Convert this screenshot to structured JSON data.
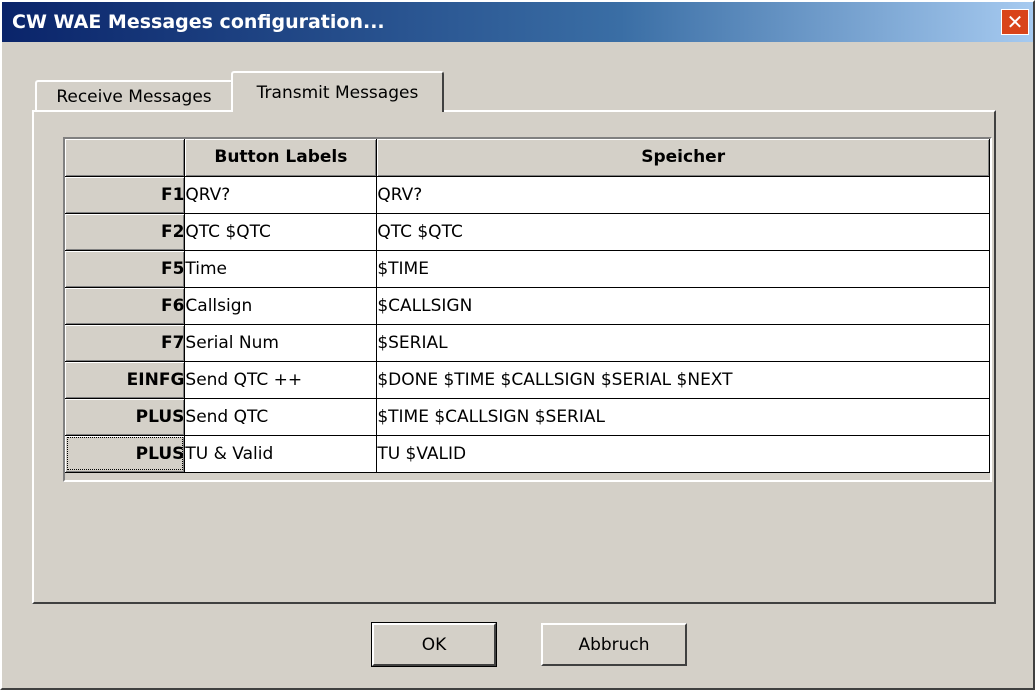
{
  "window": {
    "title": "CW WAE Messages configuration...",
    "close_label": "✕"
  },
  "tabs": [
    {
      "label": "Receive Messages",
      "active": false
    },
    {
      "label": "Transmit Messages",
      "active": true
    }
  ],
  "grid": {
    "headers": [
      "",
      "Button Labels",
      "Speicher"
    ],
    "rows": [
      {
        "key": "F1",
        "label": "QRV?",
        "memory": "QRV?"
      },
      {
        "key": "F2",
        "label": "QTC $QTC",
        "memory": "QTC $QTC"
      },
      {
        "key": "F5",
        "label": "Time",
        "memory": "$TIME"
      },
      {
        "key": "F6",
        "label": "Callsign",
        "memory": "$CALLSIGN"
      },
      {
        "key": "F7",
        "label": "Serial Num",
        "memory": "$SERIAL"
      },
      {
        "key": "EINFG",
        "label": "Send QTC ++",
        "memory": "$DONE $TIME $CALLSIGN $SERIAL $NEXT"
      },
      {
        "key": "PLUS",
        "label": "Send QTC",
        "memory": "$TIME $CALLSIGN $SERIAL"
      },
      {
        "key": "PLUS",
        "label": "TU & Valid",
        "memory": "TU $VALID"
      }
    ]
  },
  "buttons": {
    "ok": "OK",
    "cancel": "Abbruch"
  }
}
